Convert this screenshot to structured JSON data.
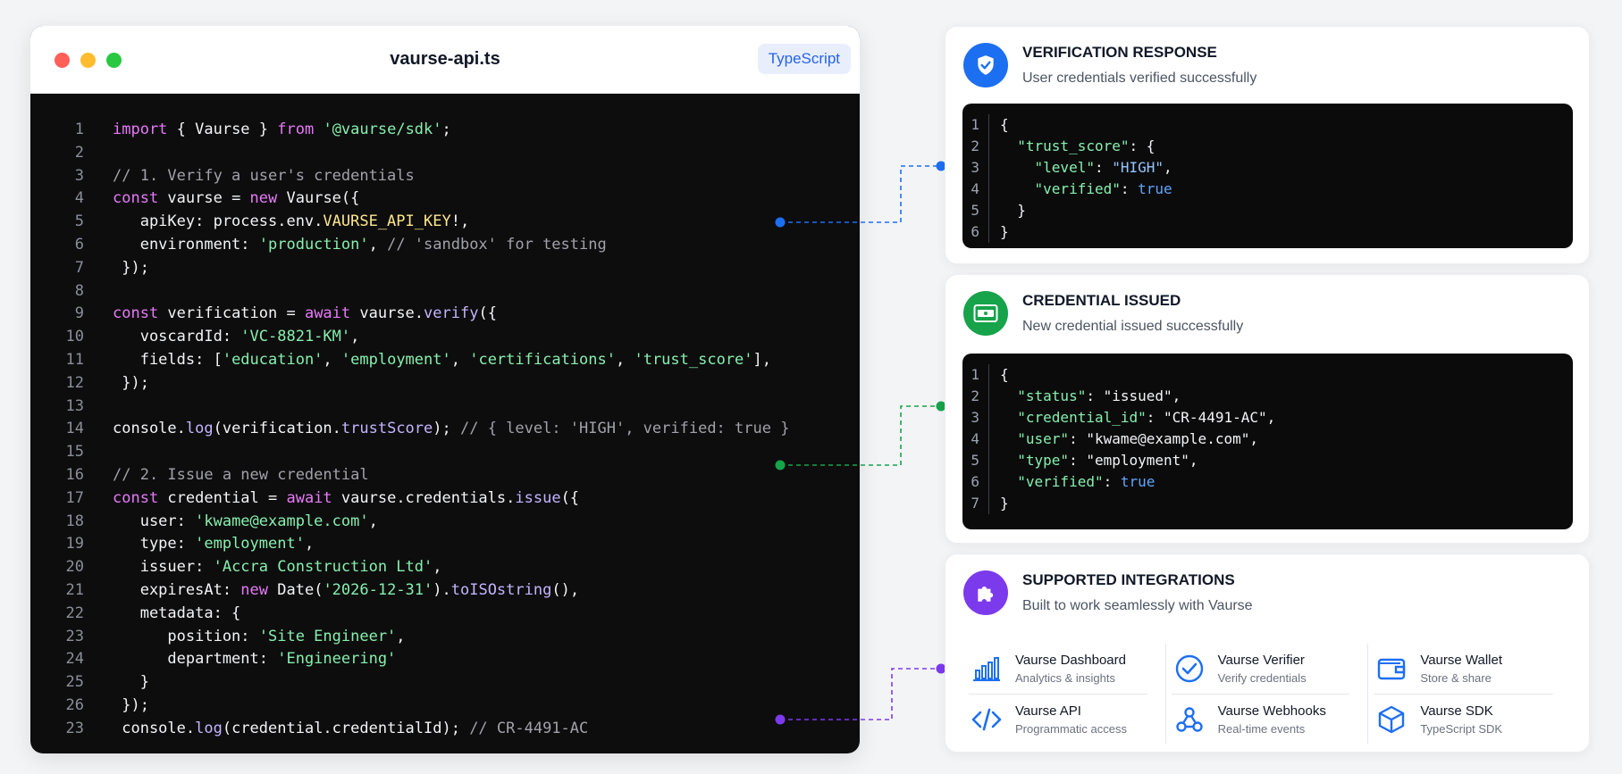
{
  "editor": {
    "filename": "vaurse-api.ts",
    "language": "TypeScript",
    "lines": [
      {
        "n": "1",
        "tokens": [
          [
            "kw",
            "import"
          ],
          [
            "p",
            " { Vaurse } "
          ],
          [
            "kw",
            "from"
          ],
          [
            "p",
            " "
          ],
          [
            "str",
            "'@vaurse/sdk'"
          ],
          [
            "p",
            ";"
          ]
        ]
      },
      {
        "n": "2",
        "tokens": []
      },
      {
        "n": "3",
        "tokens": [
          [
            "com",
            "// 1. Verify a user's credentials"
          ]
        ]
      },
      {
        "n": "4",
        "tokens": [
          [
            "kw",
            "const"
          ],
          [
            "p",
            " vaurse = "
          ],
          [
            "kw",
            "new"
          ],
          [
            "p",
            " Vaurse({"
          ]
        ]
      },
      {
        "n": "5",
        "tokens": [
          [
            "p",
            "   apiKey: process.env."
          ],
          [
            "env",
            "VAURSE_API_KEY"
          ],
          [
            "p",
            "!,"
          ]
        ]
      },
      {
        "n": "6",
        "tokens": [
          [
            "p",
            "   environment: "
          ],
          [
            "str",
            "'production'"
          ],
          [
            "p",
            ", "
          ],
          [
            "com",
            "// 'sandbox' for testing"
          ]
        ]
      },
      {
        "n": "7",
        "tokens": [
          [
            "p",
            " });"
          ]
        ]
      },
      {
        "n": "8",
        "tokens": []
      },
      {
        "n": "9",
        "tokens": [
          [
            "kw",
            "const"
          ],
          [
            "p",
            " verification = "
          ],
          [
            "kw",
            "await"
          ],
          [
            "p",
            " vaurse."
          ],
          [
            "fn",
            "verify"
          ],
          [
            "p",
            "({"
          ]
        ]
      },
      {
        "n": "10",
        "tokens": [
          [
            "p",
            "   voscardId: "
          ],
          [
            "str",
            "'VC-8821-KM'"
          ],
          [
            "p",
            ","
          ]
        ]
      },
      {
        "n": "11",
        "tokens": [
          [
            "p",
            "   fields: ["
          ],
          [
            "str",
            "'education'"
          ],
          [
            "p",
            ", "
          ],
          [
            "str",
            "'employment'"
          ],
          [
            "p",
            ", "
          ],
          [
            "str",
            "'certifications'"
          ],
          [
            "p",
            ", "
          ],
          [
            "str",
            "'trust_score'"
          ],
          [
            "p",
            "],"
          ]
        ]
      },
      {
        "n": "12",
        "tokens": [
          [
            "p",
            " });"
          ]
        ]
      },
      {
        "n": "13",
        "tokens": []
      },
      {
        "n": "14",
        "tokens": [
          [
            "p",
            "console."
          ],
          [
            "fn",
            "log"
          ],
          [
            "p",
            "(verification."
          ],
          [
            "fn",
            "trustScore"
          ],
          [
            "p",
            "); "
          ],
          [
            "com",
            "// { level: 'HIGH', verified: true }"
          ]
        ]
      },
      {
        "n": "15",
        "tokens": []
      },
      {
        "n": "16",
        "tokens": [
          [
            "com",
            "// 2. Issue a new credential"
          ]
        ]
      },
      {
        "n": "17",
        "tokens": [
          [
            "kw",
            "const"
          ],
          [
            "p",
            " credential = "
          ],
          [
            "kw",
            "await"
          ],
          [
            "p",
            " vaurse.credentials."
          ],
          [
            "fn",
            "issue"
          ],
          [
            "p",
            "({"
          ]
        ]
      },
      {
        "n": "18",
        "tokens": [
          [
            "p",
            "   user: "
          ],
          [
            "str",
            "'kwame@example.com'"
          ],
          [
            "p",
            ","
          ]
        ]
      },
      {
        "n": "19",
        "tokens": [
          [
            "p",
            "   type: "
          ],
          [
            "str",
            "'employment'"
          ],
          [
            "p",
            ","
          ]
        ]
      },
      {
        "n": "20",
        "tokens": [
          [
            "p",
            "   issuer: "
          ],
          [
            "str",
            "'Accra Construction Ltd'"
          ],
          [
            "p",
            ","
          ]
        ]
      },
      {
        "n": "21",
        "tokens": [
          [
            "p",
            "   expiresAt: "
          ],
          [
            "kw",
            "new"
          ],
          [
            "p",
            " Date("
          ],
          [
            "str",
            "'2026-12-31'"
          ],
          [
            "p",
            ")."
          ],
          [
            "fn",
            "toISOstring"
          ],
          [
            "p",
            "(),"
          ]
        ]
      },
      {
        "n": "22",
        "tokens": [
          [
            "p",
            "   metadata: {"
          ]
        ]
      },
      {
        "n": "23",
        "tokens": [
          [
            "p",
            "      position: "
          ],
          [
            "str",
            "'Site Engineer'"
          ],
          [
            "p",
            ","
          ]
        ]
      },
      {
        "n": "24",
        "tokens": [
          [
            "p",
            "      department: "
          ],
          [
            "str",
            "'Engineering'"
          ]
        ]
      },
      {
        "n": "25",
        "tokens": [
          [
            "p",
            "   }"
          ]
        ]
      },
      {
        "n": "26",
        "tokens": [
          [
            "p",
            " });"
          ]
        ]
      },
      {
        "n": "23",
        "tokens": [
          [
            "p",
            " console."
          ],
          [
            "fn",
            "log"
          ],
          [
            "p",
            "(credential.credentialId); "
          ],
          [
            "com",
            "// CR-4491-AC"
          ]
        ]
      }
    ]
  },
  "cards": {
    "verification": {
      "title": "VERIFICATION RESPONSE",
      "subtitle": "User credentials verified successfully",
      "accent": "#1d6ff2",
      "icon": "shield-check-icon",
      "json_lines": [
        {
          "n": "1",
          "tokens": [
            [
              "p",
              "{"
            ]
          ]
        },
        {
          "n": "2",
          "tokens": [
            [
              "p",
              "  "
            ],
            [
              "k",
              "\"trust_score\""
            ],
            [
              "p",
              ": {"
            ]
          ]
        },
        {
          "n": "3",
          "tokens": [
            [
              "p",
              "    "
            ],
            [
              "k",
              "\"level\""
            ],
            [
              "p",
              ": "
            ],
            [
              "s",
              "\"HIGH\""
            ],
            [
              "p",
              ","
            ]
          ]
        },
        {
          "n": "4",
          "tokens": [
            [
              "p",
              "    "
            ],
            [
              "k",
              "\"verified\""
            ],
            [
              "p",
              ": "
            ],
            [
              "b",
              "true"
            ]
          ]
        },
        {
          "n": "5",
          "tokens": [
            [
              "p",
              "  }"
            ]
          ]
        },
        {
          "n": "6",
          "tokens": [
            [
              "p",
              "}"
            ]
          ]
        }
      ]
    },
    "credential": {
      "title": "CREDENTIAL ISSUED",
      "subtitle": "New credential issued successfully",
      "accent": "#16a34a",
      "icon": "id-card-icon",
      "json_lines": [
        {
          "n": "1",
          "tokens": [
            [
              "p",
              "{"
            ]
          ]
        },
        {
          "n": "2",
          "tokens": [
            [
              "p",
              "  "
            ],
            [
              "k",
              "\"status\""
            ],
            [
              "p",
              ": \"issued\","
            ]
          ]
        },
        {
          "n": "3",
          "tokens": [
            [
              "p",
              "  "
            ],
            [
              "k",
              "\"credential_id\""
            ],
            [
              "p",
              ": \"CR-4491-AC\","
            ]
          ]
        },
        {
          "n": "4",
          "tokens": [
            [
              "p",
              "  "
            ],
            [
              "k",
              "\"user\""
            ],
            [
              "p",
              ": \"kwame@example.com\","
            ]
          ]
        },
        {
          "n": "5",
          "tokens": [
            [
              "p",
              "  "
            ],
            [
              "k",
              "\"type\""
            ],
            [
              "p",
              ": \"employment\","
            ]
          ]
        },
        {
          "n": "6",
          "tokens": [
            [
              "p",
              "  "
            ],
            [
              "k",
              "\"verified\""
            ],
            [
              "p",
              ": "
            ],
            [
              "b",
              "true"
            ]
          ]
        },
        {
          "n": "7",
          "tokens": [
            [
              "p",
              "}"
            ]
          ]
        }
      ]
    },
    "integrations": {
      "title": "SUPPORTED INTEGRATIONS",
      "subtitle": "Built to work seamlessly with Vaurse",
      "accent": "#7c3aed",
      "icon": "puzzle-icon",
      "columns": [
        [
          {
            "name": "Vaurse Dashboard",
            "desc": "Analytics & insights",
            "icon": "bar-chart-icon"
          },
          {
            "name": "Vaurse API",
            "desc": "Programmatic access",
            "icon": "code-brackets-icon"
          }
        ],
        [
          {
            "name": "Vaurse Verifier",
            "desc": "Verify credentials",
            "icon": "check-circle-icon"
          },
          {
            "name": "Vaurse Webhooks",
            "desc": "Real-time events",
            "icon": "webhook-icon"
          }
        ],
        [
          {
            "name": "Vaurse Wallet",
            "desc": "Store & share",
            "icon": "wallet-icon"
          },
          {
            "name": "Vaurse SDK",
            "desc": "TypeScript SDK",
            "icon": "cube-icon"
          }
        ]
      ]
    }
  },
  "connector_colors": [
    "#1d6ff2",
    "#16a34a",
    "#7c3aed"
  ]
}
